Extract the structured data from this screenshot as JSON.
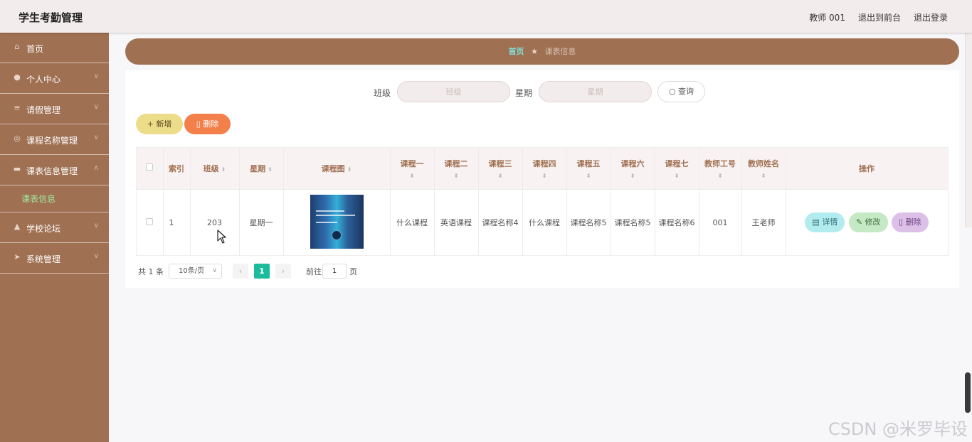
{
  "app": {
    "title": "学生考勤管理",
    "user_label": "教师 001",
    "to_front": "退出到前台",
    "logout": "退出登录"
  },
  "sidebar": {
    "items": [
      {
        "label": "首页",
        "icon": "home-icon"
      },
      {
        "label": "个人中心",
        "icon": "user-icon"
      },
      {
        "label": "请假管理",
        "icon": "list-icon"
      },
      {
        "label": "课程名称管理",
        "icon": "compass-icon"
      },
      {
        "label": "课表信息管理",
        "icon": "monitor-icon"
      },
      {
        "label": "学校论坛",
        "icon": "thumbs-up-icon"
      },
      {
        "label": "系统管理",
        "icon": "send-icon"
      }
    ],
    "submenu": {
      "label": "课表信息"
    }
  },
  "breadcrumb": {
    "home": "首页",
    "current": "课表信息"
  },
  "search": {
    "class_label": "班级",
    "class_placeholder": "班级",
    "weekday_label": "星期",
    "weekday_placeholder": "星期",
    "query_button": "查询"
  },
  "actions": {
    "add": "新增",
    "delete": "删除"
  },
  "table": {
    "headers": [
      "索引",
      "班级",
      "星期",
      "课程图",
      "课程一",
      "课程二",
      "课程三",
      "课程四",
      "课程五",
      "课程六",
      "课程七",
      "教师工号",
      "教师姓名",
      "操作"
    ],
    "rows": [
      {
        "index": "1",
        "class": "203",
        "weekday": "星期一",
        "c1": "什么课程",
        "c2": "英语课程",
        "c3": "课程名称4",
        "c4": "什么课程",
        "c5": "课程名称5",
        "c6": "课程名称5",
        "c7": "课程名称6",
        "teacher_no": "001",
        "teacher_name": "王老师",
        "ops": {
          "detail": "详情",
          "edit": "修改",
          "delete": "删除"
        }
      }
    ]
  },
  "pagination": {
    "total": "共 1 条",
    "page_size": "10条/页",
    "current_page": "1",
    "goto_label": "前往",
    "goto_value": "1",
    "page_suffix": "页"
  },
  "watermark": "CSDN @米罗毕设",
  "colors": {
    "primary": "#a07053",
    "header_bg": "#f3ecec",
    "accent_green": "#1abc9c"
  }
}
